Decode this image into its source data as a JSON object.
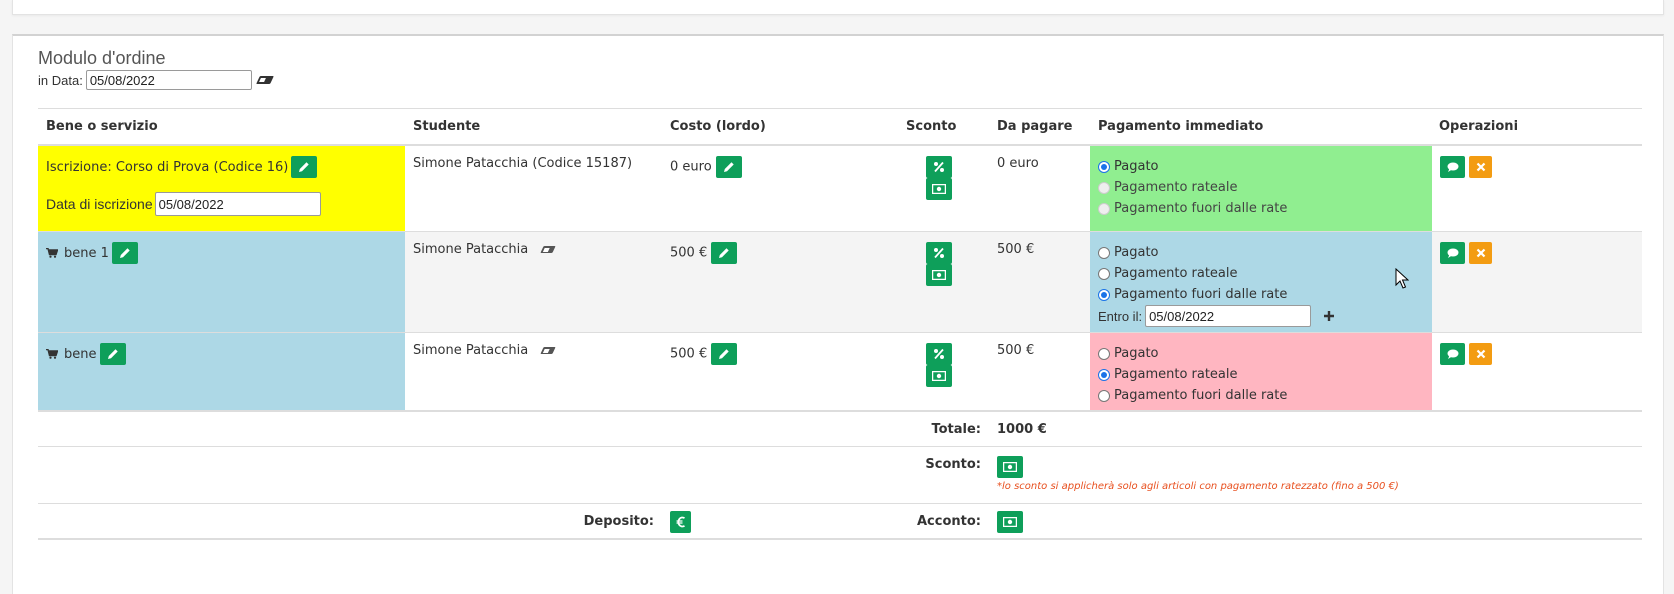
{
  "form": {
    "title": "Modulo d'ordine",
    "date_label": "in Data:",
    "date_value": "05/08/2022"
  },
  "table": {
    "headers": [
      "Bene o servizio",
      "Studente",
      "Costo (lordo)",
      "Sconto",
      "Da pagare",
      "Pagamento immediato",
      "Operazioni"
    ],
    "rows": [
      {
        "item": "Iscrizione: Corso di Prova (Codice 16)",
        "enroll_label": "Data di iscrizione",
        "enroll_date": "05/08/2022",
        "student": "Simone Patacchia (Codice 15187)",
        "cost": "0 euro",
        "due": "0 euro",
        "payment": {
          "options": [
            "Pagato",
            "Pagamento rateale",
            "Pagamento fuori dalle rate"
          ],
          "selected": "Pagato"
        },
        "colors": {
          "item_bg": "#ffff00",
          "payment_bg": "#90ee90"
        }
      },
      {
        "item": "bene 1",
        "student": "Simone Patacchia",
        "cost": "500 €",
        "due": "500 €",
        "payment": {
          "options": [
            "Pagato",
            "Pagamento rateale",
            "Pagamento fuori dalle rate"
          ],
          "selected": "Pagamento fuori dalle rate",
          "within_label": "Entro il:",
          "within_date": "05/08/2022"
        },
        "colors": {
          "item_bg": "#add8e6",
          "payment_bg": "#add8e6"
        }
      },
      {
        "item": "bene",
        "student": "Simone Patacchia",
        "cost": "500 €",
        "due": "500 €",
        "payment": {
          "options": [
            "Pagato",
            "Pagamento rateale",
            "Pagamento fuori dalle rate"
          ],
          "selected": "Pagamento rateale"
        },
        "colors": {
          "item_bg": "#add8e6",
          "payment_bg": "#ffb6c1"
        }
      }
    ]
  },
  "summary": {
    "total_label": "Totale:",
    "total_value": "1000 €",
    "discount_label": "Sconto:",
    "discount_note": "*lo sconto si applicherà solo agli articoli con pagamento ratezzato (fino a 500 €)",
    "deposit_label": "Deposito:",
    "advance_label": "Acconto:"
  },
  "icons": {
    "edit": "pencil-icon",
    "percent": "percent-icon",
    "money": "money-icon",
    "comment": "comment-icon",
    "delete": "times-icon",
    "cart": "cart-icon",
    "eraser": "eraser-icon",
    "euro": "euro-icon",
    "add": "plus-icon"
  },
  "colors": {
    "accent": "#0e9f5a",
    "warning": "#f39c12",
    "note": "#e8501f"
  }
}
